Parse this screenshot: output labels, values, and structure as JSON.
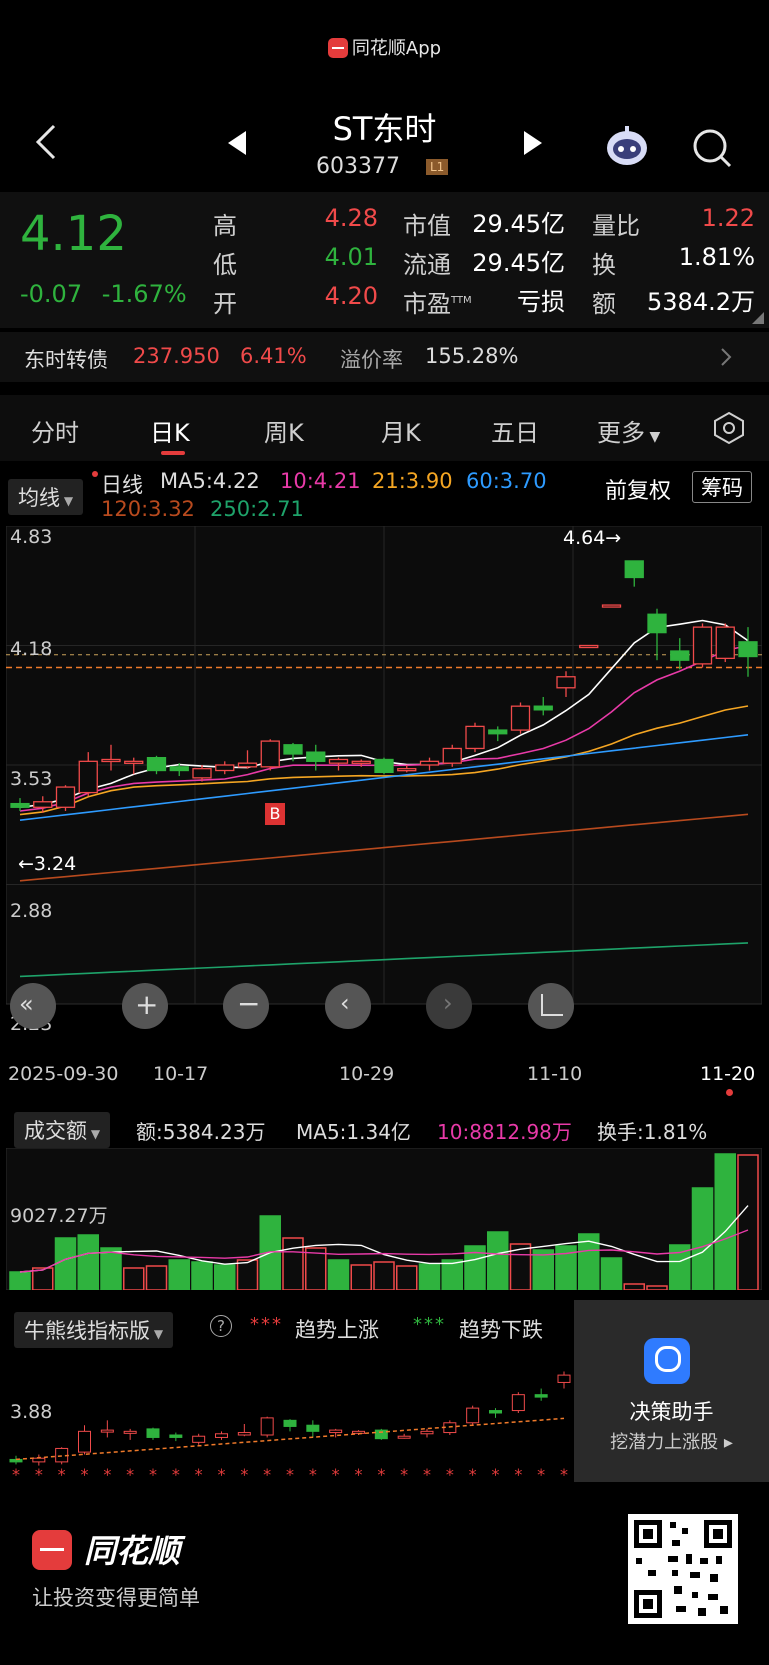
{
  "app_brand": "同花顺App",
  "header": {
    "title": "ST东时",
    "code": "603377",
    "level_badge": "L1"
  },
  "quote": {
    "price": "4.12",
    "change": "-0.07",
    "change_pct": "-1.67%",
    "high_label": "高",
    "high": "4.28",
    "low_label": "低",
    "low": "4.01",
    "open_label": "开",
    "open": "4.20",
    "mcap_label": "市值",
    "mcap": "29.45亿",
    "float_label": "流通",
    "float": "29.45亿",
    "pe_label": "市盈",
    "pe_sup": "TTM",
    "pe": "亏损",
    "vr_label": "量比",
    "vr": "1.22",
    "turnover_label": "换",
    "turnover": "1.81%",
    "amount_label": "额",
    "amount": "5384.2万"
  },
  "bond": {
    "name": "东时转债",
    "price": "237.950",
    "pct": "6.41%",
    "premium_label": "溢价率",
    "premium": "155.28%"
  },
  "tabs": {
    "t1": "分时",
    "t2": "日K",
    "t3": "周K",
    "t4": "月K",
    "t5": "五日",
    "t6": "更多"
  },
  "ma": {
    "selector": "均线",
    "line_name": "日线",
    "ma5": "MA5:4.22",
    "ma10": "10:4.21",
    "ma21": "21:3.90",
    "ma60": "60:3.70",
    "ma120": "120:3.32",
    "ma250": "250:2.71",
    "adjust": "前复权",
    "chips": "筹码",
    "colors": {
      "ma5": "#ffffff",
      "ma10": "#e83aa8",
      "ma21": "#f5a623",
      "ma60": "#2e9bff",
      "ma120": "#b84a1e",
      "ma250": "#1ea36a"
    }
  },
  "price_chart": {
    "y_labels": [
      "4.83",
      "4.18",
      "3.53",
      "2.88",
      "2.23"
    ],
    "high_note": "4.64→",
    "low_note": "←3.24",
    "buy_marker": "B",
    "dates": [
      "2025-09-30",
      "10-17",
      "10-29",
      "11-10",
      "11-20"
    ]
  },
  "volume": {
    "selector": "成交额",
    "amount": "额:5384.23万",
    "ma5": "MA5:1.34亿",
    "ma10": "10:8812.98万",
    "turnover": "换手:1.81%",
    "level": "9027.27万"
  },
  "indicator": {
    "selector": "牛熊线指标版",
    "help": "?",
    "up_legend": "趋势上涨",
    "down_legend": "趋势下跌",
    "level": "3.88"
  },
  "assistant": {
    "title": "决策助手",
    "subtitle": "挖潜力上涨股 ▸"
  },
  "footer": {
    "brand": "同花顺",
    "slogan": "让投资变得更简单"
  },
  "chart_data": {
    "type": "candlestick",
    "ylim": [
      2.23,
      4.83
    ],
    "candles": [
      {
        "o": 3.32,
        "c": 3.3,
        "h": 3.35,
        "l": 3.28
      },
      {
        "o": 3.3,
        "c": 3.33,
        "h": 3.36,
        "l": 3.27
      },
      {
        "o": 3.3,
        "c": 3.41,
        "h": 3.42,
        "l": 3.28
      },
      {
        "o": 3.38,
        "c": 3.55,
        "h": 3.6,
        "l": 3.36
      },
      {
        "o": 3.55,
        "c": 3.56,
        "h": 3.64,
        "l": 3.5
      },
      {
        "o": 3.55,
        "c": 3.55,
        "h": 3.57,
        "l": 3.48
      },
      {
        "o": 3.57,
        "c": 3.5,
        "h": 3.58,
        "l": 3.48
      },
      {
        "o": 3.52,
        "c": 3.5,
        "h": 3.54,
        "l": 3.47
      },
      {
        "o": 3.46,
        "c": 3.51,
        "h": 3.53,
        "l": 3.44
      },
      {
        "o": 3.5,
        "c": 3.53,
        "h": 3.55,
        "l": 3.48
      },
      {
        "o": 3.52,
        "c": 3.54,
        "h": 3.61,
        "l": 3.51
      },
      {
        "o": 3.52,
        "c": 3.66,
        "h": 3.67,
        "l": 3.5
      },
      {
        "o": 3.64,
        "c": 3.59,
        "h": 3.65,
        "l": 3.55
      },
      {
        "o": 3.6,
        "c": 3.55,
        "h": 3.64,
        "l": 3.5
      },
      {
        "o": 3.54,
        "c": 3.56,
        "h": 3.57,
        "l": 3.5
      },
      {
        "o": 3.54,
        "c": 3.55,
        "h": 3.56,
        "l": 3.52
      },
      {
        "o": 3.56,
        "c": 3.49,
        "h": 3.57,
        "l": 3.48
      },
      {
        "o": 3.51,
        "c": 3.51,
        "h": 3.53,
        "l": 3.49
      },
      {
        "o": 3.53,
        "c": 3.55,
        "h": 3.57,
        "l": 3.5
      },
      {
        "o": 3.54,
        "c": 3.62,
        "h": 3.64,
        "l": 3.52
      },
      {
        "o": 3.62,
        "c": 3.74,
        "h": 3.76,
        "l": 3.6
      },
      {
        "o": 3.72,
        "c": 3.7,
        "h": 3.74,
        "l": 3.66
      },
      {
        "o": 3.72,
        "c": 3.85,
        "h": 3.87,
        "l": 3.7
      },
      {
        "o": 3.85,
        "c": 3.83,
        "h": 3.9,
        "l": 3.8
      },
      {
        "o": 3.95,
        "c": 4.01,
        "h": 4.04,
        "l": 3.9
      },
      {
        "o": 4.18,
        "c": 4.18,
        "h": 4.18,
        "l": 4.18
      },
      {
        "o": 4.4,
        "c": 4.4,
        "h": 4.4,
        "l": 4.4
      },
      {
        "o": 4.64,
        "c": 4.55,
        "h": 4.64,
        "l": 4.5
      },
      {
        "o": 4.35,
        "c": 4.25,
        "h": 4.38,
        "l": 4.1
      },
      {
        "o": 4.15,
        "c": 4.1,
        "h": 4.22,
        "l": 4.05
      },
      {
        "o": 4.08,
        "c": 4.28,
        "h": 4.3,
        "l": 4.06
      },
      {
        "o": 4.11,
        "c": 4.28,
        "h": 4.3,
        "l": 4.09
      },
      {
        "o": 4.2,
        "c": 4.12,
        "h": 4.28,
        "l": 4.01
      }
    ],
    "volume_up": [
      false,
      true,
      false,
      false,
      false,
      true,
      true,
      false,
      false,
      false,
      true,
      false,
      true,
      true,
      false,
      true,
      true,
      true,
      false,
      false,
      false,
      false,
      true,
      false,
      false,
      false,
      false,
      true,
      true,
      false,
      false,
      false,
      true
    ]
  }
}
